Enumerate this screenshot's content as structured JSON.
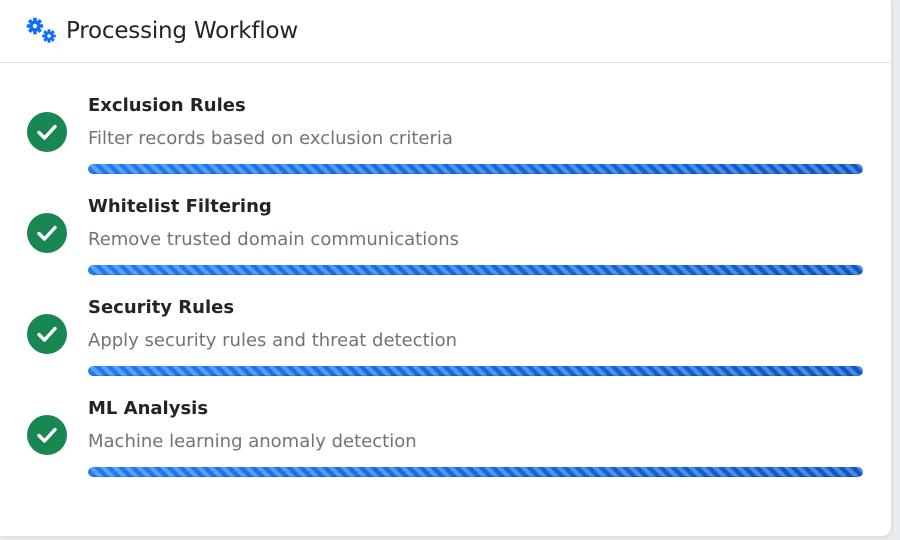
{
  "header": {
    "title": "Processing Workflow",
    "icon": "cogs-icon",
    "accent_color": "#0d6efd"
  },
  "steps": [
    {
      "title": "Exclusion Rules",
      "description": "Filter records based on exclusion criteria",
      "status": "complete",
      "progress": 1.0
    },
    {
      "title": "Whitelist Filtering",
      "description": "Remove trusted domain communications",
      "status": "complete",
      "progress": 1.0
    },
    {
      "title": "Security Rules",
      "description": "Apply security rules and threat detection",
      "status": "complete",
      "progress": 1.0
    },
    {
      "title": "ML Analysis",
      "description": "Machine learning anomaly detection",
      "status": "complete",
      "progress": 1.0
    }
  ],
  "colors": {
    "complete": "#198754",
    "progress": "#0d6efd"
  }
}
